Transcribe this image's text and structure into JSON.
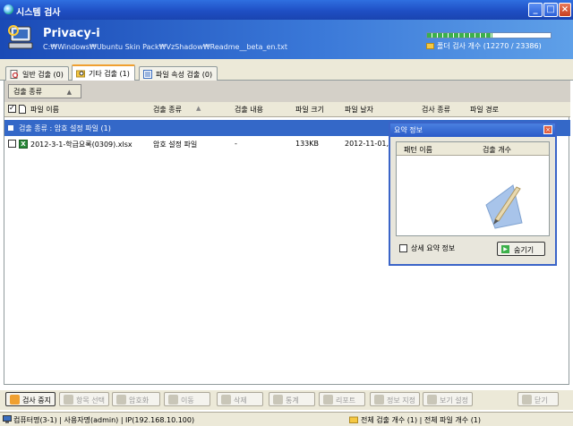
{
  "window": {
    "title": "시스템 검사"
  },
  "header": {
    "app_name": "Privacy-i",
    "scan_path": "C:₩Windows₩Ubuntu Skin Pack₩VzShadow₩Readme__beta_en.txt",
    "progress_fraction": 0.527,
    "folder_count_text": "폴더 검사 개수 (12270 / 23386)"
  },
  "tabs": [
    {
      "label": "일반 검출 (0)",
      "icon": "document-search-icon",
      "active": false
    },
    {
      "label": "기타 검출 (1)",
      "icon": "folder-search-icon",
      "active": true
    },
    {
      "label": "파일 속성 검출 (0)",
      "icon": "file-properties-icon",
      "active": false
    }
  ],
  "group_button": {
    "label": "검출 종류"
  },
  "columns": [
    "파일 이름",
    "검출 종류",
    "검출 내용",
    "파일 크기",
    "파일 날자",
    "검사 종류",
    "파일 경로"
  ],
  "group_row": {
    "label": "검출 종류 : 암호 설정 파일 (1)"
  },
  "rows": [
    {
      "file_name": "2012-3-1-학급요록(0309).xlsx",
      "detect_type": "암호 설정 파일",
      "detect_content": "-",
      "size": "133KB",
      "date": "2012-11-01, 0("
    }
  ],
  "summary_popup": {
    "title": "요약 정보",
    "col_pattern": "패턴 이름",
    "col_count": "검출 개수",
    "detail_checkbox_label": "상세 요약 정보",
    "hide_button": "숨기기"
  },
  "toolbar": {
    "stop": "검사 중지",
    "select": "항목 선택",
    "encrypt": "암호화",
    "move": "이동",
    "delete": "삭제",
    "stats": "통계",
    "report": "리포트",
    "info": "정보 지정",
    "view": "보기 설정",
    "close": "닫기"
  },
  "status": {
    "computer": "컴퓨터명(3-1) | 사용자명(admin) | IP(192.168.10.100)",
    "totals": "전체 검출 개수 (1) | 전체 파일 개수 (1)"
  },
  "colors": {
    "title_blue": "#2a5ac8",
    "group_row": "#3468c8",
    "progress_green": "#3bb04a"
  }
}
